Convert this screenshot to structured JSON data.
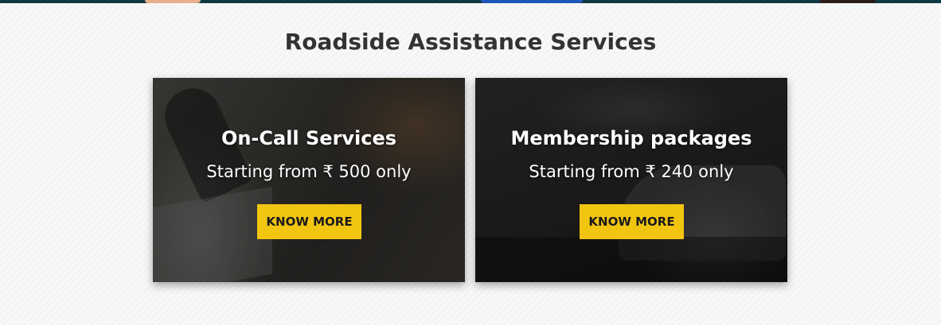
{
  "section": {
    "title": "Roadside Assistance Services"
  },
  "cards": [
    {
      "title": "On-Call Services",
      "subtitle": "Starting from ₹ 500 only",
      "button_label": "KNOW MORE"
    },
    {
      "title": "Membership packages",
      "subtitle": "Starting from ₹ 240 only",
      "button_label": "KNOW MORE"
    }
  ],
  "colors": {
    "button_bg": "#f2c511",
    "title_color": "#333333",
    "banner_bg": "#0d3a44"
  }
}
